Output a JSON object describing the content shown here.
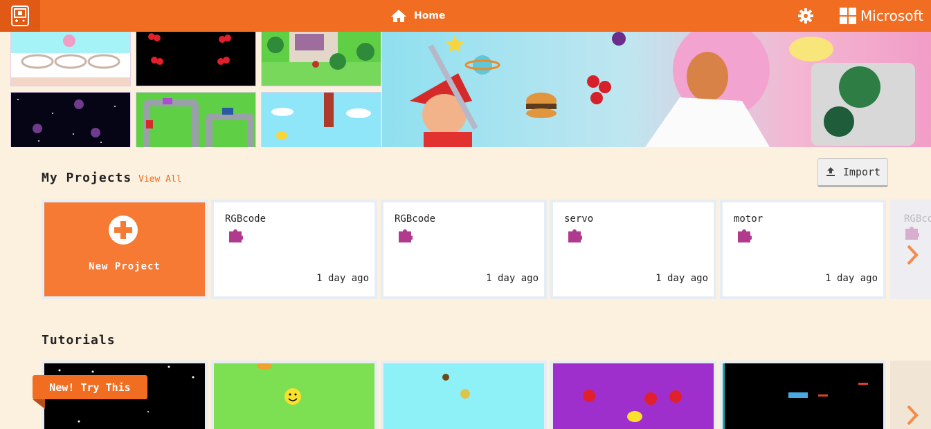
{
  "topbar": {
    "home_label": "Home",
    "brand_label": "Microsoft",
    "icons": [
      "editor-logo-icon",
      "home-icon",
      "gear-icon",
      "microsoft-logo-icon"
    ],
    "color": "#f06d22"
  },
  "my_projects": {
    "title": "My Projects",
    "view_all": "View All",
    "import_label": "Import",
    "new_project_label": "New Project",
    "projects": [
      {
        "name": "RGBcode",
        "time": "1 day ago"
      },
      {
        "name": "RGBcode",
        "time": "1 day ago"
      },
      {
        "name": "servo",
        "time": "1 day ago"
      },
      {
        "name": "motor",
        "time": "1 day ago"
      }
    ],
    "partial_name": "RGBco"
  },
  "tutorials": {
    "title": "Tutorials",
    "badge": "New! Try This"
  },
  "colors": {
    "accent": "#f06d22",
    "puzzle": "#b13a8e",
    "page_bg": "#fcf0df"
  }
}
